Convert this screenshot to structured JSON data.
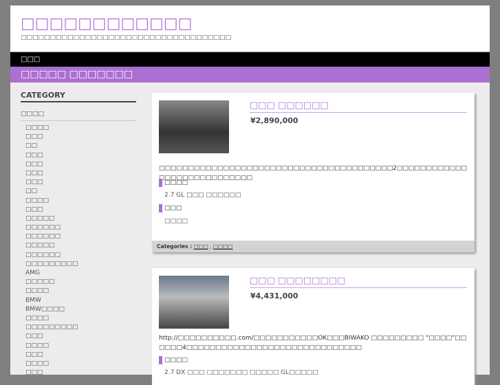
{
  "header": {
    "title": "□□□□□□□□□□□□",
    "tagline": "□□□□□□□□□□□□□□□□□□□□□□□□□□□□□□□□□□□□"
  },
  "nav": {
    "home": "□□□"
  },
  "band": {
    "text": "□□□□□ □□□□□□□"
  },
  "sidebar": {
    "heading": "CATEGORY",
    "subheading": "□□□□",
    "items": [
      "□□□□",
      "□□□",
      "□□",
      "□□□",
      "□□□",
      "□□□",
      "□□□",
      "□□",
      "□□□□",
      "□□□",
      "□□□□□",
      "□□□□□□",
      "□□□□□□",
      "□□□□□",
      "□□□□□□",
      "□□□□□□□□□",
      "AMG",
      "□□□□□",
      "□□□□",
      "BMW",
      "BMW□□□□",
      "□□□□",
      "□□□□□□□□□",
      "□□□",
      "□□□□",
      "□□□",
      "□□□□",
      "□□□"
    ]
  },
  "posts": [
    {
      "title": "□□□ □□□□□□",
      "price": "¥2,890,000",
      "desc": "□□□□□□□□□□□□□□□□□□□□□□□□□□□□□□□□□□□□□□□□2□□□□□□□□□□□□□□□□□□□□□□□□□□□□",
      "sec1": "□□□□",
      "sec1_val": "2.7 GL □□□ □□□□□□",
      "sec2": "□□□",
      "sec2_val": "□□□□",
      "categories_label": "Categories :",
      "cat1": "□□□",
      "cat2": "□□□□"
    },
    {
      "title": "□□□ □□□□□□□□",
      "price": "¥4,431,000",
      "desc": "http://□□□□□□□□□□.com/□□□□□□□□□□□OK□□□BIWAKO □□□□□□□□□ \"□□□□\"□□□□□□4□□□□□□□□□□□□□□□□□□□□□□□□□□□□□□",
      "sec1": "□□□□",
      "sec1_val": "2.7 DX □□□ □□□□□□□ □□□□□ GL□□□□□"
    }
  ]
}
